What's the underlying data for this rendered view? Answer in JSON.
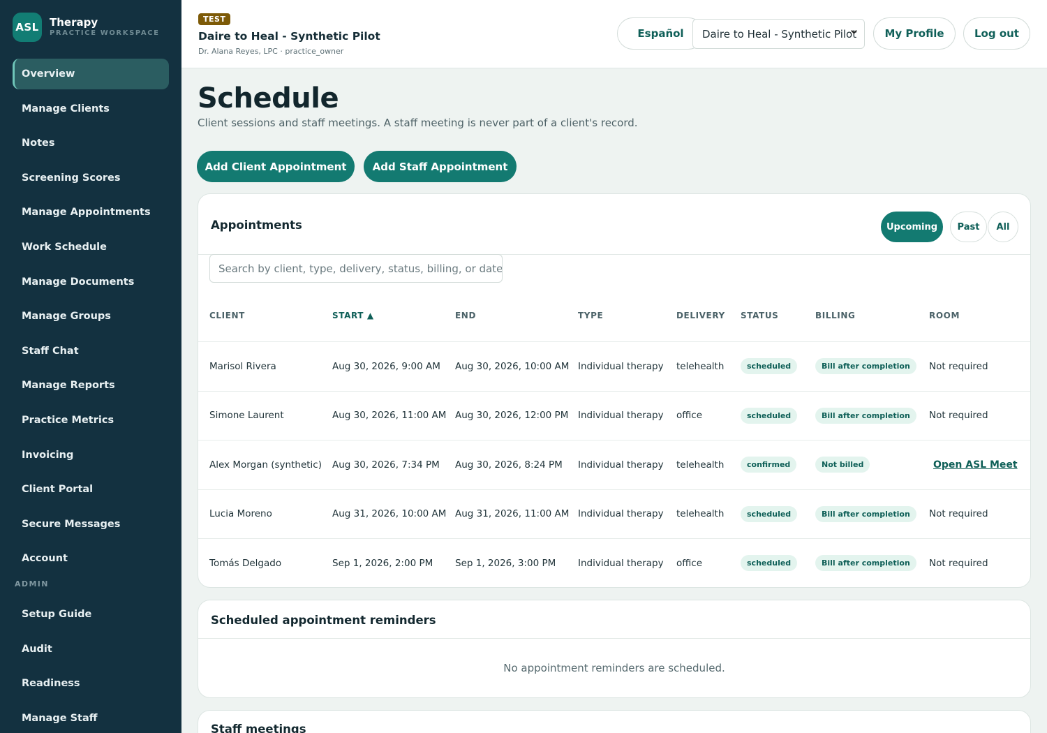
{
  "brand": {
    "logo": "ASL",
    "title": "Therapy",
    "subtitle": "PRACTICE WORKSPACE"
  },
  "sidebar": {
    "items": [
      {
        "label": "Overview",
        "active": true
      },
      {
        "label": "Manage Clients"
      },
      {
        "label": "Notes"
      },
      {
        "label": "Screening Scores"
      },
      {
        "label": "Manage Appointments"
      },
      {
        "label": "Work Schedule"
      },
      {
        "label": "Manage Documents"
      },
      {
        "label": "Manage Groups"
      },
      {
        "label": "Staff Chat"
      },
      {
        "label": "Manage Reports"
      },
      {
        "label": "Practice Metrics"
      },
      {
        "label": "Invoicing"
      },
      {
        "label": "Client Portal"
      },
      {
        "label": "Secure Messages"
      },
      {
        "label": "Account"
      }
    ],
    "admin_label": "ADMIN",
    "admin_items": [
      {
        "label": "Setup Guide"
      },
      {
        "label": "Audit"
      },
      {
        "label": "Readiness"
      },
      {
        "label": "Manage Staff"
      }
    ]
  },
  "header": {
    "badge": "TEST",
    "practice_name": "Daire to Heal - Synthetic Pilot",
    "practice_sub": "Dr. Alana Reyes, LPC · practice_owner",
    "language_button": "Español",
    "practice_select": "Daire to Heal - Synthetic Pilot",
    "profile_button": "My Profile",
    "logout_button": "Log out"
  },
  "page": {
    "title": "Schedule",
    "subtitle": "Client sessions and staff meetings. A staff meeting is never part of a client's record.",
    "add_client_button": "Add Client Appointment",
    "add_staff_button": "Add Staff Appointment"
  },
  "appointments": {
    "title": "Appointments",
    "filters": [
      "Upcoming",
      "Past",
      "All"
    ],
    "active_filter": "Upcoming",
    "search_placeholder": "Search by client, type, delivery, status, billing, or date..",
    "columns": [
      "CLIENT",
      "START ▲",
      "END",
      "TYPE",
      "DELIVERY",
      "STATUS",
      "BILLING",
      "ROOM"
    ],
    "rows": [
      {
        "client": "Marisol Rivera",
        "start": "Aug 30, 2026, 9:00 AM",
        "end": "Aug 30, 2026, 10:00 AM",
        "type": "Individual therapy",
        "delivery": "telehealth",
        "status": "scheduled",
        "billing": "Bill after completion",
        "room": "Not required"
      },
      {
        "client": "Simone Laurent",
        "start": "Aug 30, 2026, 11:00 AM",
        "end": "Aug 30, 2026, 12:00 PM",
        "type": "Individual therapy",
        "delivery": "office",
        "status": "scheduled",
        "billing": "Bill after completion",
        "room": "Not required"
      },
      {
        "client": "Alex Morgan (synthetic)",
        "start": "Aug 30, 2026, 7:34 PM",
        "end": "Aug 30, 2026, 8:24 PM",
        "type": "Individual therapy",
        "delivery": "telehealth",
        "status": "confirmed",
        "billing": "Not billed",
        "room": "Open ASL Meet"
      },
      {
        "client": "Lucia Moreno",
        "start": "Aug 31, 2026, 10:00 AM",
        "end": "Aug 31, 2026, 11:00 AM",
        "type": "Individual therapy",
        "delivery": "telehealth",
        "status": "scheduled",
        "billing": "Bill after completion",
        "room": "Not required"
      },
      {
        "client": "Tomás Delgado",
        "start": "Sep 1, 2026, 2:00 PM",
        "end": "Sep 1, 2026, 3:00 PM",
        "type": "Individual therapy",
        "delivery": "office",
        "status": "scheduled",
        "billing": "Bill after completion",
        "room": "Not required"
      }
    ]
  },
  "reminders": {
    "title": "Scheduled appointment reminders",
    "empty": "No appointment reminders are scheduled."
  },
  "staff_meetings": {
    "title": "Staff meetings"
  }
}
